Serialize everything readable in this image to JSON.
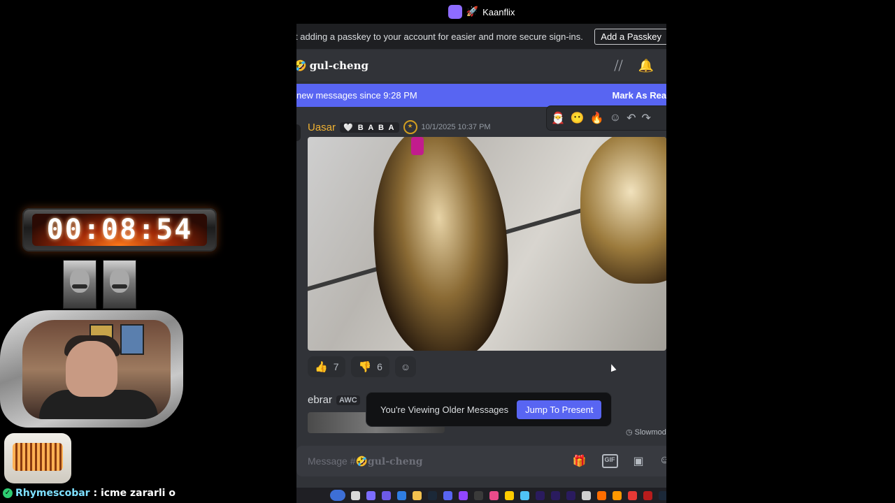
{
  "overlay": {
    "timer": "00:08:54",
    "chat": {
      "user": "Rhymescobar",
      "separator": ":",
      "message": "icme zararli o"
    }
  },
  "topbar": {
    "server_name": "Kaanflix",
    "server_icon": "podcast-icon",
    "rocket_icon": "rocket-icon"
  },
  "notice": {
    "text": "t adding a passkey to your account for easier and more secure sign-ins.",
    "button": "Add a Passkey"
  },
  "channel": {
    "emoji": "🤣",
    "name": "gul-cheng",
    "icons": [
      "threads-icon",
      "bell-icon"
    ]
  },
  "new_messages": {
    "text": "new messages since 9:28 PM",
    "action": "Mark As Read"
  },
  "message": {
    "author": "Uasar",
    "tag": "B A B A",
    "tag_icon": "heart-icon",
    "timestamp": "10/1/2025 10:37 PM",
    "author_color": "#f0b232",
    "hover_actions": [
      "reaction-1-icon",
      "reaction-2-icon",
      "fire-icon",
      "add-reaction-icon",
      "reply-icon",
      "forward-icon"
    ],
    "reactions": [
      {
        "icon": "thumbs-up-icon",
        "count": "7"
      },
      {
        "icon": "thumbs-down-icon",
        "count": "6"
      }
    ]
  },
  "next_message": {
    "author": "ebrar",
    "tag": "AWC"
  },
  "older_toast": {
    "label": "You're Viewing Older Messages",
    "button": "Jump To Present"
  },
  "slowmode": {
    "text": "Slowmode"
  },
  "composer": {
    "placeholder_prefix": "Message #",
    "emoji": "🤣",
    "channel": "gul-cheng"
  },
  "colors": {
    "accent": "#5865f2",
    "background": "#313338",
    "header": "#1e1f22"
  }
}
